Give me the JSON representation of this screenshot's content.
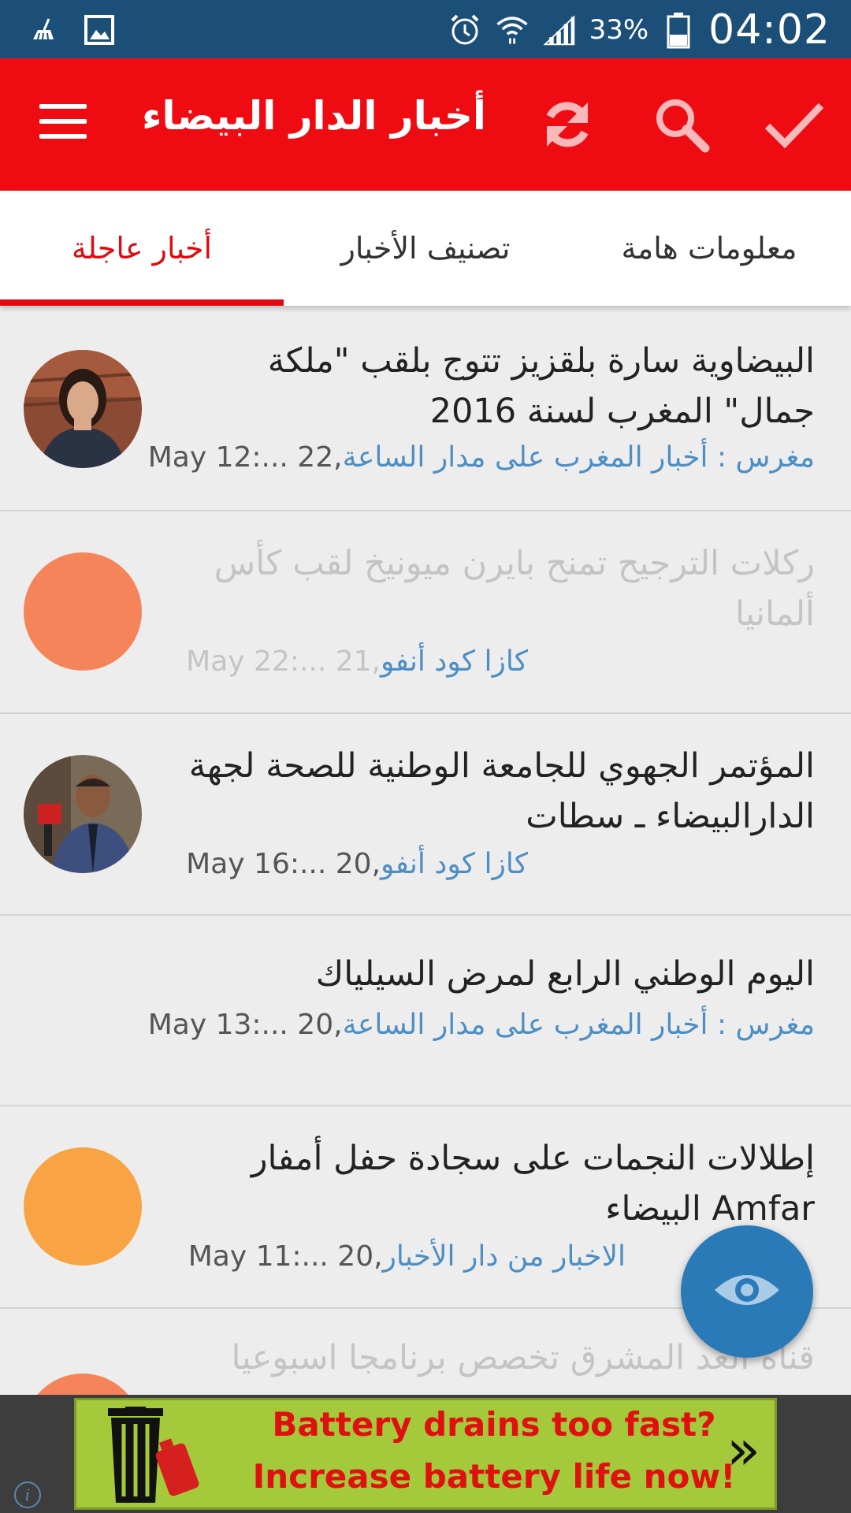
{
  "status_bar": {
    "battery_percent": "33%",
    "time": "04:02",
    "icons": [
      "cleaner-icon",
      "image-icon",
      "alarm-icon",
      "wifi-icon",
      "signal-icon",
      "battery-icon"
    ]
  },
  "app_bar": {
    "title": "أخبار الدار البيضاء",
    "icons": [
      "menu-icon",
      "refresh-icon",
      "search-icon",
      "check-icon"
    ],
    "color": "#ee0c12"
  },
  "tabs": [
    {
      "label": "أخبار عاجلة",
      "active": true
    },
    {
      "label": "تصنيف الأخبار",
      "active": false
    },
    {
      "label": "معلومات هامة",
      "active": false
    }
  ],
  "feed": {
    "items": [
      {
        "title": "البيضاوية سارة بلقزيز تتوج بلقب \"ملكة جمال\" المغرب لسنة 2016",
        "source": "مغرس : أخبار المغرب على مدار الساعة",
        "date": "May 12:... 22",
        "avatar": "photo-woman",
        "read": false
      },
      {
        "title": "ركلات الترجيح تمنح بايرن ميونيخ لقب كأس ألمانيا",
        "source": "كازا كود أنفو",
        "date": "May 22:... 21",
        "avatar": "#f5845b",
        "read": true
      },
      {
        "title": "المؤتمر الجهوي للجامعة الوطنية للصحة لجهة الدارالبيضاء ـ سطات",
        "source": "كازا كود أنفو",
        "date": "May 16:... 20",
        "avatar": "photo-man",
        "read": false
      },
      {
        "title": "اليوم الوطني الرابع لمرض السيلياك",
        "source": "مغرس : أخبار المغرب على مدار الساعة",
        "date": "May 13:... 20",
        "avatar": "",
        "read": false
      },
      {
        "title": "إطلالات النجمات على سجادة حفل أمفار Amfar البيضاء",
        "source": "الاخبار من دار الأخبار",
        "date": "May 11:... 20",
        "avatar": "#f9a444",
        "read": false
      },
      {
        "title": "قناة الغد المشرق تخصص برنامجا اسبوعيا",
        "source": "",
        "date": "",
        "avatar": "#f5845b",
        "read": true
      }
    ]
  },
  "fab": {
    "icon": "eye-icon",
    "color": "#2a7ab8"
  },
  "ad": {
    "line1": "Battery drains too fast?",
    "line2": "Increase battery life now!",
    "icon": "trash-battery-icon",
    "arrow": "»",
    "info": "i"
  }
}
